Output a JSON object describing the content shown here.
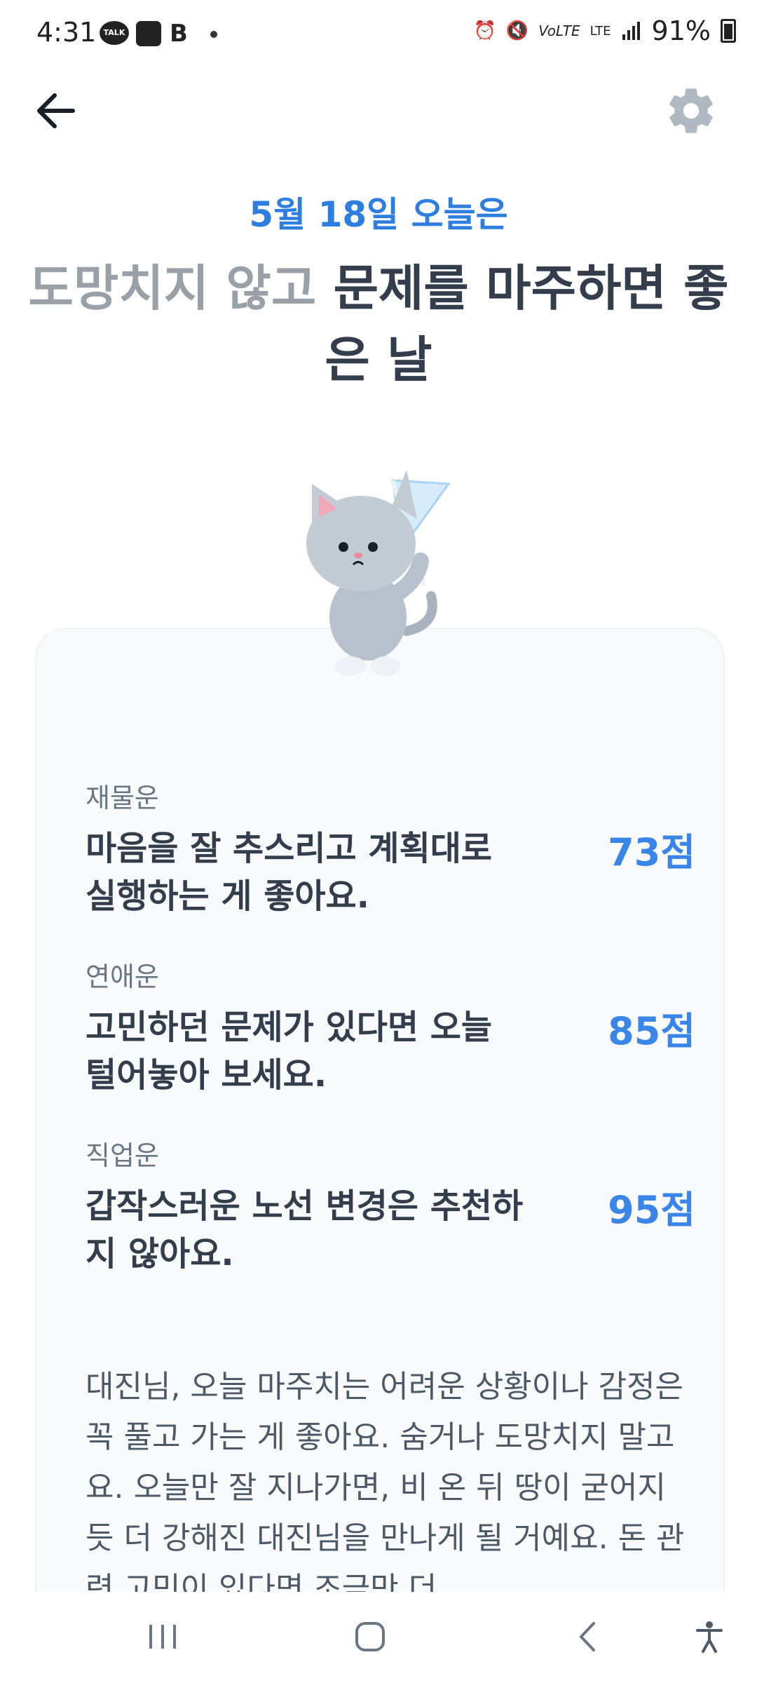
{
  "status_bar": {
    "time": "4:31",
    "battery": "91%",
    "icons": [
      "talk-icon",
      "app-icon",
      "b-icon",
      "dot-icon",
      "alarm-icon",
      "mute-icon",
      "volte-icon",
      "lte-icon",
      "signal-icon",
      "battery-icon"
    ]
  },
  "header": {
    "back_icon": "arrow-left-icon",
    "settings_icon": "gear-icon"
  },
  "date": "5월 18일 오늘은",
  "headline": {
    "part_faded": "도망치지 않고 ",
    "part_main": "문제를 마주하면 좋은 날"
  },
  "fortunes": [
    {
      "label": "재물운",
      "description": "마음을 잘 추스리고 계획대로 실행하는 게 좋아요.",
      "score": "73점"
    },
    {
      "label": "연애운",
      "description": "고민하던 문제가 있다면 오늘 털어놓아 보세요.",
      "score": "85점"
    },
    {
      "label": "직업운",
      "description": "갑작스러운 노선 변경은 추천하지 않아요.",
      "score": "95점"
    }
  ],
  "summary": "대진님, 오늘 마주치는 어려운 상황이나 감정은 꼭 풀고 가는 게 좋아요. 숨거나 도망치지 말고요. 오늘만 잘 지나가면, 비 온 뒤 땅이 굳어지듯 더 강해진 대진님을 만나게 될 거예요. 돈 관련 고민이 있다면 조금만 더",
  "colors": {
    "accent": "#3a86e8",
    "text_main": "#333d4b",
    "text_faded": "#9aa0a8",
    "card_bg": "#f9fafb"
  },
  "nav": [
    "recent-apps-icon",
    "home-icon",
    "back-icon",
    "accessibility-icon"
  ]
}
